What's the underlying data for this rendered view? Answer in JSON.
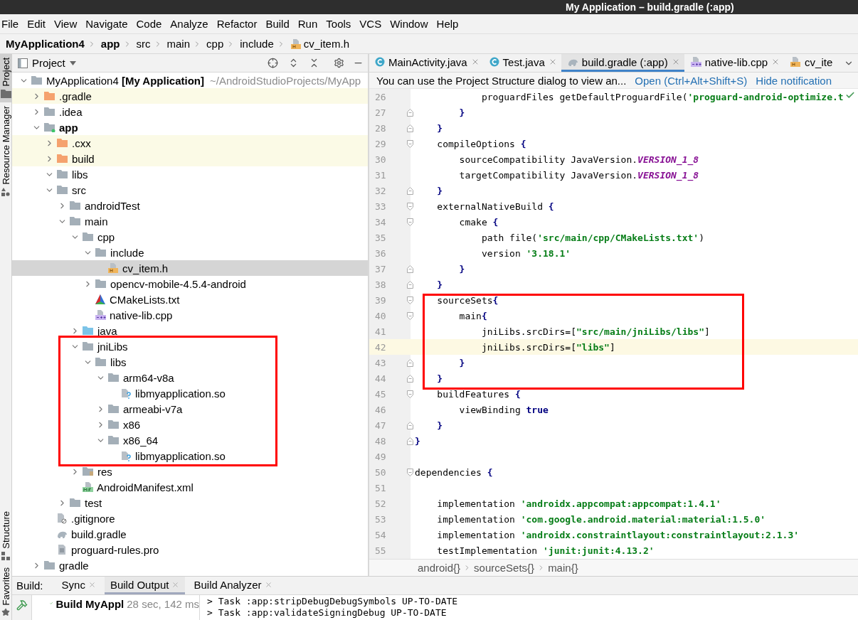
{
  "window": {
    "title": "My Application – build.gradle (:app)"
  },
  "menu": [
    "File",
    "Edit",
    "View",
    "Navigate",
    "Code",
    "Analyze",
    "Refactor",
    "Build",
    "Run",
    "Tools",
    "VCS",
    "Window",
    "Help"
  ],
  "breadcrumbs": [
    {
      "label": "MyApplication4",
      "bold": true,
      "kind": "folder"
    },
    {
      "label": "app",
      "bold": true,
      "kind": "folder"
    },
    {
      "label": "src",
      "bold": false,
      "kind": "folder"
    },
    {
      "label": "main",
      "bold": false,
      "kind": "folder"
    },
    {
      "label": "cpp",
      "bold": false,
      "kind": "folder"
    },
    {
      "label": "include",
      "bold": false,
      "kind": "folder"
    },
    {
      "label": "cv_item.h",
      "bold": false,
      "kind": "header"
    }
  ],
  "tool_strip": {
    "top": [
      {
        "label": "Project",
        "selected": true,
        "kind": "folder"
      },
      {
        "label": "Resource Manager",
        "selected": false,
        "kind": "shapes"
      }
    ],
    "bottom": [
      {
        "label": "Structure",
        "selected": false,
        "kind": "structure"
      },
      {
        "label": "Favorites",
        "selected": false,
        "kind": "star"
      }
    ]
  },
  "project_panel": {
    "title": "Project",
    "tree": [
      {
        "label": "MyApplication4 **[My Application]**",
        "path": "~/AndroidStudioProjects/MyApp",
        "kind": "module",
        "expanded": true,
        "selected": false,
        "excluded": false,
        "boxed": false,
        "bold": false,
        "children": [
          {
            "label": ".gradle",
            "kind": "folder",
            "expanded": false,
            "selected": false,
            "excluded": true,
            "boxed": false,
            "bold": false
          },
          {
            "label": ".idea",
            "kind": "folder",
            "expanded": false,
            "selected": false,
            "excluded": false,
            "boxed": false,
            "bold": false
          },
          {
            "label": "app",
            "kind": "module",
            "expanded": true,
            "selected": false,
            "excluded": false,
            "boxed": false,
            "bold": true,
            "children": [
              {
                "label": ".cxx",
                "kind": "folder",
                "expanded": false,
                "selected": false,
                "excluded": true,
                "boxed": false,
                "bold": false
              },
              {
                "label": "build",
                "kind": "folder",
                "expanded": false,
                "selected": false,
                "excluded": true,
                "boxed": false,
                "bold": false
              },
              {
                "label": "libs",
                "kind": "folder",
                "expanded": true,
                "selected": false,
                "excluded": false,
                "boxed": false,
                "bold": false
              },
              {
                "label": "src",
                "kind": "folder",
                "expanded": true,
                "selected": false,
                "excluded": false,
                "boxed": false,
                "bold": false,
                "children": [
                  {
                    "label": "androidTest",
                    "kind": "folder",
                    "expanded": false,
                    "selected": false,
                    "excluded": false,
                    "boxed": false,
                    "bold": false
                  },
                  {
                    "label": "main",
                    "kind": "folder",
                    "expanded": true,
                    "selected": false,
                    "excluded": false,
                    "boxed": false,
                    "bold": false,
                    "children": [
                      {
                        "label": "cpp",
                        "kind": "folder",
                        "expanded": true,
                        "selected": false,
                        "excluded": false,
                        "boxed": false,
                        "bold": false,
                        "children": [
                          {
                            "label": "include",
                            "kind": "folder",
                            "expanded": true,
                            "selected": false,
                            "excluded": false,
                            "boxed": false,
                            "bold": false,
                            "children": [
                              {
                                "label": "cv_item.h",
                                "kind": "header",
                                "selected": true,
                                "excluded": false,
                                "boxed": false,
                                "bold": false
                              }
                            ]
                          },
                          {
                            "label": "opencv-mobile-4.5.4-android",
                            "kind": "folder",
                            "expanded": false,
                            "selected": false,
                            "excluded": false,
                            "boxed": false,
                            "bold": false
                          },
                          {
                            "label": "CMakeLists.txt",
                            "kind": "cmake",
                            "selected": false,
                            "excluded": false,
                            "boxed": false,
                            "bold": false
                          },
                          {
                            "label": "native-lib.cpp",
                            "kind": "cpp",
                            "selected": false,
                            "excluded": false,
                            "boxed": false,
                            "bold": false
                          }
                        ]
                      },
                      {
                        "label": "java",
                        "kind": "source",
                        "expanded": false,
                        "selected": false,
                        "excluded": false,
                        "boxed": false,
                        "bold": false
                      },
                      {
                        "label": "jniLibs",
                        "kind": "folder",
                        "expanded": true,
                        "selected": false,
                        "excluded": false,
                        "boxed": true,
                        "bold": false,
                        "children": [
                          {
                            "label": "libs",
                            "kind": "folder",
                            "expanded": true,
                            "selected": false,
                            "excluded": false,
                            "boxed": false,
                            "bold": false,
                            "children": [
                              {
                                "label": "arm64-v8a",
                                "kind": "folder",
                                "expanded": true,
                                "selected": false,
                                "excluded": false,
                                "boxed": false,
                                "bold": false,
                                "children": [
                                  {
                                    "label": "libmyapplication.so",
                                    "kind": "library",
                                    "selected": false,
                                    "excluded": false,
                                    "boxed": false,
                                    "bold": false
                                  }
                                ]
                              },
                              {
                                "label": "armeabi-v7a",
                                "kind": "folder",
                                "expanded": false,
                                "selected": false,
                                "excluded": false,
                                "boxed": false,
                                "bold": false
                              },
                              {
                                "label": "x86",
                                "kind": "folder",
                                "expanded": false,
                                "selected": false,
                                "excluded": false,
                                "boxed": false,
                                "bold": false
                              },
                              {
                                "label": "x86_64",
                                "kind": "folder",
                                "expanded": true,
                                "selected": false,
                                "excluded": false,
                                "boxed": false,
                                "bold": false,
                                "children": [
                                  {
                                    "label": "libmyapplication.so",
                                    "kind": "library",
                                    "selected": false,
                                    "excluded": false,
                                    "boxed": false,
                                    "bold": false
                                  }
                                ]
                              }
                            ]
                          }
                        ]
                      },
                      {
                        "label": "res",
                        "kind": "resources",
                        "expanded": false,
                        "selected": false,
                        "excluded": false,
                        "boxed": false,
                        "bold": false
                      },
                      {
                        "label": "AndroidManifest.xml",
                        "kind": "manifest",
                        "selected": false,
                        "excluded": false,
                        "boxed": false,
                        "bold": false
                      }
                    ]
                  },
                  {
                    "label": "test",
                    "kind": "folder",
                    "expanded": false,
                    "selected": false,
                    "excluded": false,
                    "boxed": false,
                    "bold": false
                  }
                ]
              },
              {
                "label": ".gitignore",
                "kind": "ignore",
                "selected": false,
                "excluded": false,
                "boxed": false,
                "bold": false
              },
              {
                "label": "build.gradle",
                "kind": "gradle",
                "selected": false,
                "excluded": false,
                "boxed": false,
                "bold": false
              },
              {
                "label": "proguard-rules.pro",
                "kind": "text",
                "selected": false,
                "excluded": false,
                "boxed": false,
                "bold": false
              }
            ]
          },
          {
            "label": "gradle",
            "kind": "folder",
            "expanded": false,
            "selected": false,
            "excluded": false,
            "boxed": false,
            "bold": false
          }
        ]
      }
    ]
  },
  "editor": {
    "tabs": [
      {
        "label": "MainActivity.java",
        "kind": "class",
        "selected": false
      },
      {
        "label": "Test.java",
        "kind": "class",
        "selected": false
      },
      {
        "label": "build.gradle (:app)",
        "kind": "gradle",
        "selected": true
      },
      {
        "label": "native-lib.cpp",
        "kind": "cpp",
        "selected": false
      },
      {
        "label": "cv_ite",
        "kind": "header",
        "selected": false
      }
    ],
    "notification": {
      "text": "You can use the Project Structure dialog to view an...",
      "links": [
        "Open (Ctrl+Alt+Shift+S)",
        "Hide notification"
      ]
    },
    "lines": [
      {
        "n": "26",
        "kind": "plain",
        "current": false,
        "boxed": false,
        "segs": [
          {
            "t": "            proguardFiles getDefaultProguardFile(",
            "kind": "plain"
          },
          {
            "t": "'proguard-android-optimize.t",
            "kind": "string"
          }
        ]
      },
      {
        "n": "27",
        "kind": "fold_end",
        "current": false,
        "boxed": false,
        "segs": [
          {
            "t": "        }",
            "kind": "keyword"
          }
        ]
      },
      {
        "n": "28",
        "kind": "fold_end",
        "current": false,
        "boxed": false,
        "segs": [
          {
            "t": "    }",
            "kind": "keyword"
          }
        ]
      },
      {
        "n": "29",
        "kind": "fold_start",
        "current": false,
        "boxed": false,
        "segs": [
          {
            "t": "    compileOptions ",
            "kind": "plain"
          },
          {
            "t": "{",
            "kind": "keyword"
          }
        ]
      },
      {
        "n": "30",
        "kind": "plain",
        "current": false,
        "boxed": false,
        "segs": [
          {
            "t": "        sourceCompatibility JavaVersion.",
            "kind": "plain"
          },
          {
            "t": "VERSION_1_8",
            "kind": "constant"
          }
        ]
      },
      {
        "n": "31",
        "kind": "plain",
        "current": false,
        "boxed": false,
        "segs": [
          {
            "t": "        targetCompatibility JavaVersion.",
            "kind": "plain"
          },
          {
            "t": "VERSION_1_8",
            "kind": "constant"
          }
        ]
      },
      {
        "n": "32",
        "kind": "fold_end",
        "current": false,
        "boxed": false,
        "segs": [
          {
            "t": "    }",
            "kind": "keyword"
          }
        ]
      },
      {
        "n": "33",
        "kind": "fold_start",
        "current": false,
        "boxed": false,
        "segs": [
          {
            "t": "    externalNativeBuild ",
            "kind": "plain"
          },
          {
            "t": "{",
            "kind": "keyword"
          }
        ]
      },
      {
        "n": "34",
        "kind": "fold_start",
        "current": false,
        "boxed": false,
        "segs": [
          {
            "t": "        cmake ",
            "kind": "plain"
          },
          {
            "t": "{",
            "kind": "keyword"
          }
        ]
      },
      {
        "n": "35",
        "kind": "plain",
        "current": false,
        "boxed": false,
        "segs": [
          {
            "t": "            path file(",
            "kind": "plain"
          },
          {
            "t": "'src/main/cpp/CMakeLists.txt'",
            "kind": "string"
          },
          {
            "t": ")",
            "kind": "plain"
          }
        ]
      },
      {
        "n": "36",
        "kind": "plain",
        "current": false,
        "boxed": false,
        "segs": [
          {
            "t": "            version ",
            "kind": "plain"
          },
          {
            "t": "'3.18.1'",
            "kind": "string"
          }
        ]
      },
      {
        "n": "37",
        "kind": "fold_end",
        "current": false,
        "boxed": false,
        "segs": [
          {
            "t": "        }",
            "kind": "keyword"
          }
        ]
      },
      {
        "n": "38",
        "kind": "fold_end",
        "current": false,
        "boxed": false,
        "segs": [
          {
            "t": "    }",
            "kind": "keyword"
          }
        ]
      },
      {
        "n": "39",
        "kind": "fold_start",
        "current": false,
        "boxed": true,
        "segs": [
          {
            "t": "    sourceSets",
            "kind": "plain"
          },
          {
            "t": "{",
            "kind": "keyword"
          }
        ]
      },
      {
        "n": "40",
        "kind": "fold_start",
        "current": false,
        "boxed": true,
        "segs": [
          {
            "t": "        main",
            "kind": "plain"
          },
          {
            "t": "{",
            "kind": "keyword"
          }
        ]
      },
      {
        "n": "41",
        "kind": "plain",
        "current": false,
        "boxed": true,
        "segs": [
          {
            "t": "            jniLibs.srcDirs=[",
            "kind": "plain"
          },
          {
            "t": "\"src/main/jniLibs/libs\"",
            "kind": "string"
          },
          {
            "t": "]",
            "kind": "plain"
          }
        ]
      },
      {
        "n": "42",
        "kind": "plain",
        "current": true,
        "boxed": true,
        "segs": [
          {
            "t": "            jniLibs.srcDirs=[",
            "kind": "plain"
          },
          {
            "t": "\"libs\"",
            "kind": "string"
          },
          {
            "t": "]",
            "kind": "plain"
          }
        ]
      },
      {
        "n": "43",
        "kind": "fold_end",
        "current": false,
        "boxed": true,
        "segs": [
          {
            "t": "        }",
            "kind": "keyword"
          }
        ]
      },
      {
        "n": "44",
        "kind": "fold_end",
        "current": false,
        "boxed": true,
        "segs": [
          {
            "t": "    }",
            "kind": "keyword"
          }
        ]
      },
      {
        "n": "45",
        "kind": "fold_start",
        "current": false,
        "boxed": false,
        "segs": [
          {
            "t": "    buildFeatures ",
            "kind": "plain"
          },
          {
            "t": "{",
            "kind": "keyword"
          }
        ]
      },
      {
        "n": "46",
        "kind": "plain",
        "current": false,
        "boxed": false,
        "segs": [
          {
            "t": "        viewBinding ",
            "kind": "plain"
          },
          {
            "t": "true",
            "kind": "keyword"
          }
        ]
      },
      {
        "n": "47",
        "kind": "fold_end",
        "current": false,
        "boxed": false,
        "segs": [
          {
            "t": "    }",
            "kind": "keyword"
          }
        ]
      },
      {
        "n": "48",
        "kind": "fold_end",
        "current": false,
        "boxed": false,
        "segs": [
          {
            "t": "}",
            "kind": "keyword"
          }
        ]
      },
      {
        "n": "49",
        "kind": "plain",
        "current": false,
        "boxed": false
      },
      {
        "n": "50",
        "kind": "fold_start",
        "current": false,
        "boxed": false,
        "segs": [
          {
            "t": "dependencies ",
            "kind": "plain"
          },
          {
            "t": "{",
            "kind": "keyword"
          }
        ]
      },
      {
        "n": "51",
        "kind": "plain",
        "current": false,
        "boxed": false
      },
      {
        "n": "52",
        "kind": "plain",
        "current": false,
        "boxed": false,
        "segs": [
          {
            "t": "    implementation ",
            "kind": "plain"
          },
          {
            "t": "'androidx.appcompat:appcompat:1.4.1'",
            "kind": "string"
          }
        ]
      },
      {
        "n": "53",
        "kind": "plain",
        "current": false,
        "boxed": false,
        "segs": [
          {
            "t": "    implementation ",
            "kind": "plain"
          },
          {
            "t": "'com.google.android.material:material:1.5.0'",
            "kind": "string"
          }
        ]
      },
      {
        "n": "54",
        "kind": "plain",
        "current": false,
        "boxed": false,
        "segs": [
          {
            "t": "    implementation ",
            "kind": "plain"
          },
          {
            "t": "'androidx.constraintlayout:constraintlayout:2.1.3'",
            "kind": "string"
          }
        ]
      },
      {
        "n": "55",
        "kind": "plain",
        "current": false,
        "boxed": false,
        "segs": [
          {
            "t": "    testImplementation ",
            "kind": "plain"
          },
          {
            "t": "'junit:junit:4.13.2'",
            "kind": "string"
          }
        ]
      }
    ],
    "breadcrumbs": [
      "android{}",
      "sourceSets{}",
      "main{}"
    ]
  },
  "build": {
    "label": "Build:",
    "tabs": [
      {
        "label": "Sync",
        "selected": false
      },
      {
        "label": "Build Output",
        "selected": true
      },
      {
        "label": "Build Analyzer",
        "selected": false
      }
    ],
    "result": {
      "label": "Build MyAppl",
      "time": "28 sec, 142 ms",
      "kind": "success"
    },
    "output": [
      "> Task :app:stripDebugDebugSymbols UP-TO-DATE",
      "> Task :app:validateSigningDebug UP-TO-DATE"
    ]
  }
}
